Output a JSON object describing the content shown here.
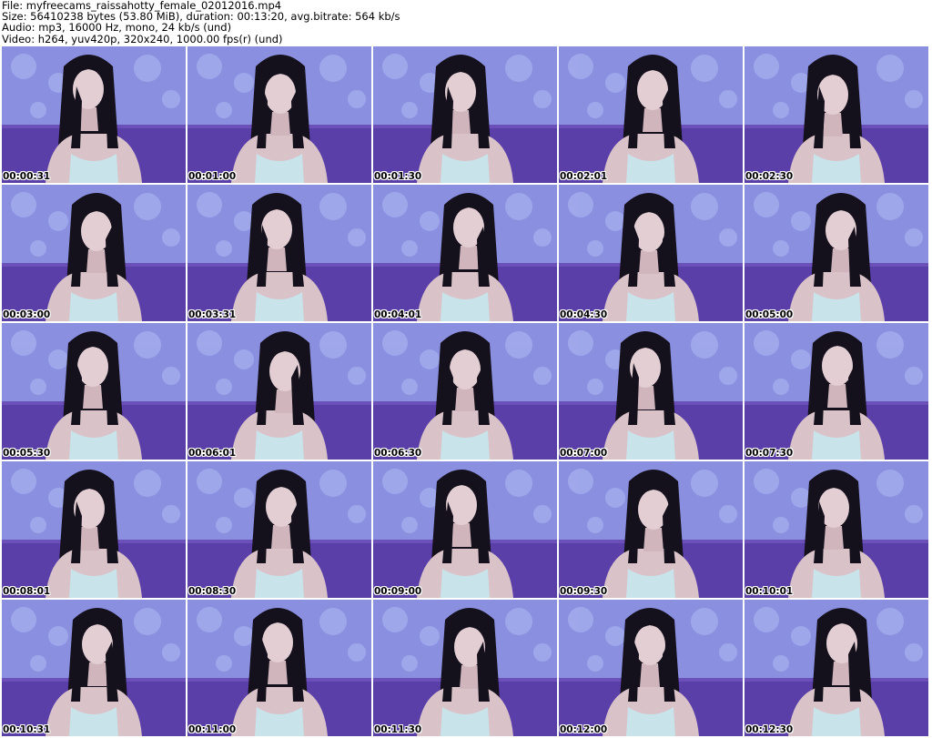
{
  "header": {
    "file_line": "File: myfreecams_raissahotty_female_02012016.mp4",
    "size_line": "Size: 56410238 bytes (53.80 MiB), duration: 00:13:20, avg.bitrate: 564 kb/s",
    "audio_line": "Audio: mp3, 16000 Hz, mono, 24 kb/s (und)",
    "video_line": "Video: h264, yuv420p, 320x240, 1000.00 fps(r) (und)"
  },
  "thumbnails": [
    {
      "timestamp": "00:00:31"
    },
    {
      "timestamp": "00:01:00"
    },
    {
      "timestamp": "00:01:30"
    },
    {
      "timestamp": "00:02:01"
    },
    {
      "timestamp": "00:02:30"
    },
    {
      "timestamp": "00:03:00"
    },
    {
      "timestamp": "00:03:31"
    },
    {
      "timestamp": "00:04:01"
    },
    {
      "timestamp": "00:04:30"
    },
    {
      "timestamp": "00:05:00"
    },
    {
      "timestamp": "00:05:30"
    },
    {
      "timestamp": "00:06:01"
    },
    {
      "timestamp": "00:06:30"
    },
    {
      "timestamp": "00:07:00"
    },
    {
      "timestamp": "00:07:30"
    },
    {
      "timestamp": "00:08:01"
    },
    {
      "timestamp": "00:08:30"
    },
    {
      "timestamp": "00:09:00"
    },
    {
      "timestamp": "00:09:30"
    },
    {
      "timestamp": "00:10:01"
    },
    {
      "timestamp": "00:10:31"
    },
    {
      "timestamp": "00:11:00"
    },
    {
      "timestamp": "00:11:30"
    },
    {
      "timestamp": "00:12:00"
    },
    {
      "timestamp": "00:12:30"
    }
  ],
  "colors": {
    "wallpaper": "#8a8fe0",
    "couch": "#5a3fa8",
    "skin": "#d9c3c8",
    "hair": "#14101c",
    "top": "#c9e3ea"
  }
}
